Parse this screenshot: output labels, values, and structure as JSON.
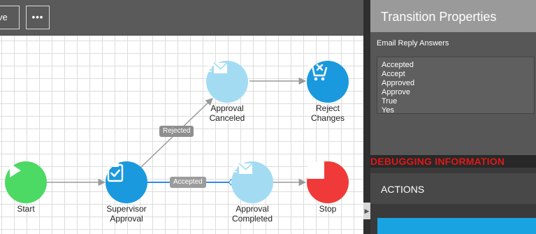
{
  "toolbar": {
    "save_label": "ve",
    "more_label": "•••"
  },
  "workflow": {
    "nodes": {
      "start": {
        "label": "Start",
        "color": "#4cd964",
        "icon": "play-icon"
      },
      "supervisor_approval": {
        "label_line1": "Supervisor",
        "label_line2": "Approval",
        "color": "#1a99de",
        "icon": "clipboard-check-icon"
      },
      "approval_canceled": {
        "label_line1": "Approval",
        "label_line2": "Canceled",
        "color": "#a3dcf2",
        "icon": "email-send-icon"
      },
      "reject_changes": {
        "label_line1": "Reject",
        "label_line2": "Changes",
        "color": "#1a99de",
        "icon": "cart-remove-icon"
      },
      "approval_completed": {
        "label_line1": "Approval",
        "label_line2": "Completed",
        "color": "#a3dcf2",
        "icon": "email-send-icon"
      },
      "stop": {
        "label": "Stop",
        "color": "#f03a3a",
        "icon": "stop-icon"
      }
    },
    "edges": {
      "rejected_label": "Rejected",
      "accepted_label": "Accepted",
      "selected_color": "#2b8ce6",
      "default_color": "#9a9a9a"
    }
  },
  "panel": {
    "title": "Transition Properties",
    "field_label": "Email Reply Answers",
    "answers": [
      "Accepted",
      "Accept",
      "Approved",
      "Approve",
      "True",
      "Yes"
    ],
    "debug_text": "DEBUGGING INFORMATION",
    "actions_label": "ACTIONS",
    "accent_color": "#1aa3e1"
  }
}
